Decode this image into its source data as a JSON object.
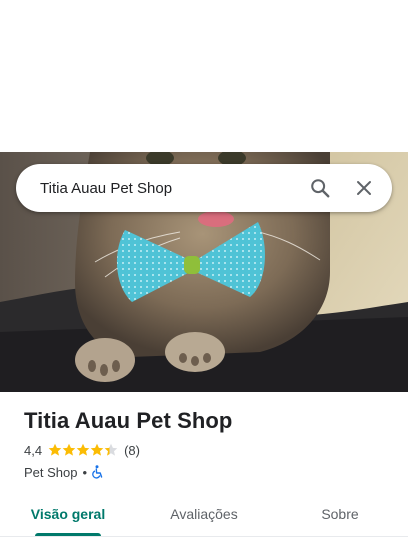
{
  "search": {
    "query": "Titia Auau Pet Shop"
  },
  "hero": {
    "image": "cat-with-bowtie-photo"
  },
  "place": {
    "name": "Titia Auau Pet Shop",
    "rating": "4,4",
    "rating_value": 4.4,
    "review_count": "(8)",
    "category": "Pet Shop",
    "separator": "•",
    "accessibility_icon": "wheelchair-icon"
  },
  "tabs": [
    {
      "label": "Visão geral",
      "active": true
    },
    {
      "label": "Avaliações",
      "active": false
    },
    {
      "label": "Sobre",
      "active": false
    }
  ],
  "colors": {
    "accent": "#00796b",
    "star": "#fbbc04",
    "accessibility": "#1a73e8"
  }
}
